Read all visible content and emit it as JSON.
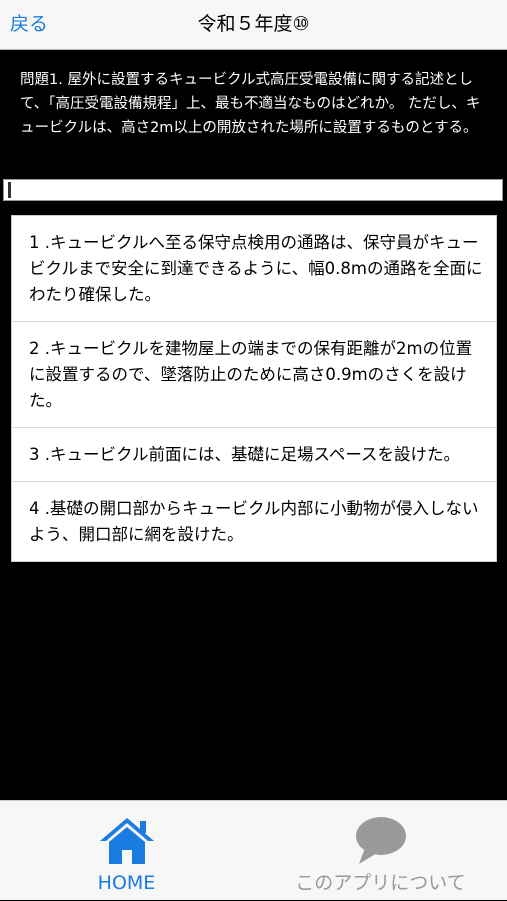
{
  "navbar": {
    "back_label": "戻る",
    "title": "令和５年度⑩"
  },
  "question": {
    "text": "問題1. 屋外に設置するキュービクル式高圧受電設備に関する記述として、「高圧受電設備規程」上、最も不適当なものはどれか。 ただし、キュービクルは、高さ2m以上の開放された場所に設置するものとする。"
  },
  "answer_input": {
    "value": ""
  },
  "choices": [
    {
      "label": "1 .キュービクルへ至る保守点検用の通路は、保守員がキュービクルまで安全に到達できるように、幅0.8mの通路を全面にわたり確保した。"
    },
    {
      "label": "2 .キュービクルを建物屋上の端までの保有距離が2mの位置に設置するので、墜落防止のために高さ0.9mのさくを設けた。"
    },
    {
      "label": "3 .キュービクル前面には、基礎に足場スペースを設けた。"
    },
    {
      "label": "4 .基礎の開口部からキュービクル内部に小動物が侵入しないよう、開口部に網を設けた。"
    }
  ],
  "tabbar": {
    "home": {
      "label": "HOME",
      "icon": "home-icon",
      "color": "#1a7be0"
    },
    "about": {
      "label": "このアプリについて",
      "icon": "speech-bubble-icon",
      "color": "#9a9a9a"
    }
  }
}
